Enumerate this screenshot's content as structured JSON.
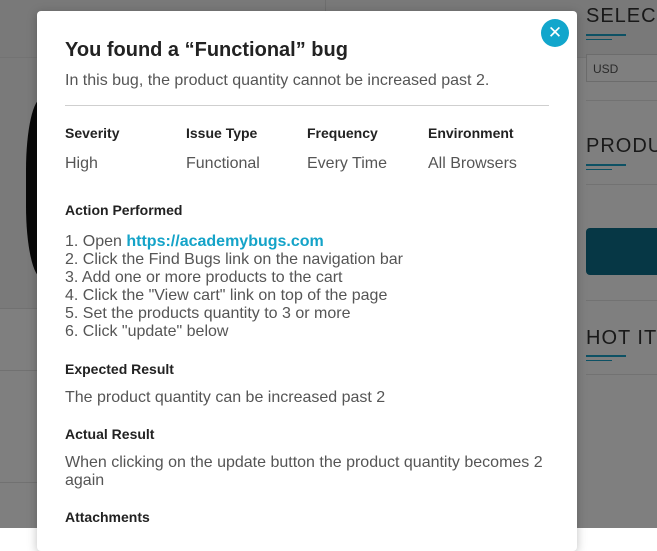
{
  "background": {
    "side_headings": [
      "SELEC",
      "PRODU",
      "HOT IT"
    ],
    "currency_value": "USD"
  },
  "modal": {
    "close_symbol": "✕",
    "title": "You found a “Functional” bug",
    "description": "In this bug, the product quantity cannot be increased past 2.",
    "meta": [
      {
        "label": "Severity",
        "value": "High"
      },
      {
        "label": "Issue Type",
        "value": "Functional"
      },
      {
        "label": "Frequency",
        "value": "Every Time"
      },
      {
        "label": "Environment",
        "value": "All Browsers"
      }
    ],
    "action_performed": {
      "title": "Action Performed",
      "step1_prefix": "1. Open ",
      "step1_link": "https://academybugs.com",
      "steps": [
        "2. Click the Find Bugs link on the navigation bar",
        "3. Add one or more products to the cart",
        "4. Click the \"View cart\" link on top of the page",
        "5. Set the products quantity to 3 or more",
        "6. Click \"update\" below"
      ]
    },
    "expected_result": {
      "title": "Expected Result",
      "text": "The product quantity can be increased past 2"
    },
    "actual_result": {
      "title": "Actual Result",
      "text": "When clicking on the update button the product quantity becomes 2 again"
    },
    "attachments_title": "Attachments"
  }
}
